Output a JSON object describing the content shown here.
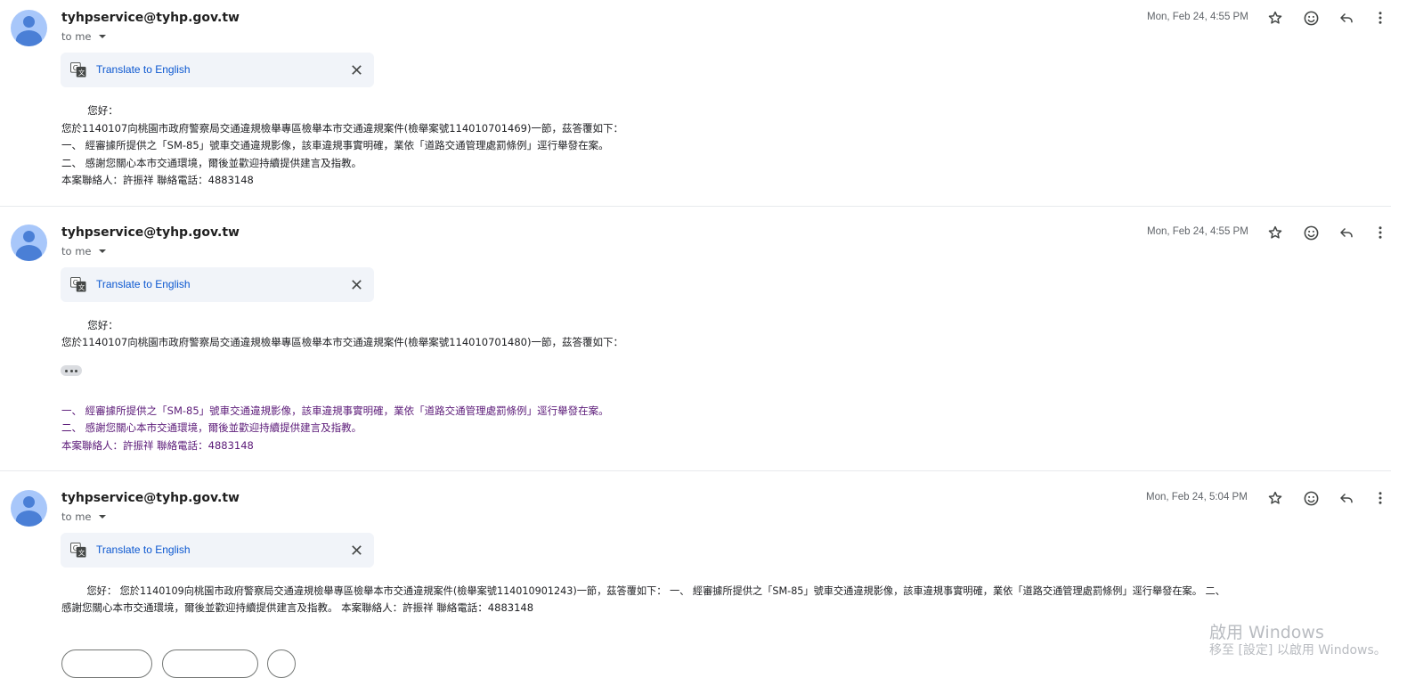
{
  "messages": [
    {
      "sender": "tyhpservice@tyhp.gov.tw",
      "to": "to me",
      "date": "Mon, Feb 24, 4:55 PM",
      "translate": "Translate to English",
      "body": [
        "        您好：",
        "您於1140107向桃園市政府警察局交通違規檢舉專區檢舉本市交通違規案件(檢舉案號114010701469)一節，茲答覆如下：",
        "一、 經審據所提供之「SM-85」號車交通違規影像，該車違規事實明確，業依「道路交通管理處罰條例」逕行舉發在案。",
        "二、 感謝您關心本市交通環境，爾後並歡迎持續提供建言及指教。",
        "本案聯絡人：許振祥 聯絡電話：4883148"
      ]
    },
    {
      "sender": "tyhpservice@tyhp.gov.tw",
      "to": "to me",
      "date": "Mon, Feb 24, 4:55 PM",
      "translate": "Translate to English",
      "body": [
        "        您好：",
        "您於1140107向桃園市政府警察局交通違規檢舉專區檢舉本市交通違規案件(檢舉案號114010701480)一節，茲答覆如下："
      ],
      "quoted": [
        "一、 經審據所提供之「SM-85」號車交通違規影像，該車違規事實明確，業依「道路交通管理處罰條例」逕行舉發在案。",
        "二、 感謝您關心本市交通環境，爾後並歡迎持續提供建言及指教。",
        "本案聯絡人：許振祥 聯絡電話：4883148"
      ]
    },
    {
      "sender": "tyhpservice@tyhp.gov.tw",
      "to": "to me",
      "date": "Mon, Feb 24, 5:04 PM",
      "translate": "Translate to English",
      "body": [
        "        您好： 您於1140109向桃園市政府警察局交通違規檢舉專區檢舉本市交通違規案件(檢舉案號114010901243)一節，茲答覆如下： 一、 經審據所提供之「SM-85」號車交通違規影像，該車違規事實明確，業依「道路交通管理處罰條例」逕行舉發在案。 二、",
        "感謝您關心本市交通環境，爾後並歡迎持續提供建言及指教。 本案聯絡人：許振祥 聯絡電話：4883148"
      ]
    }
  ],
  "watermark": {
    "line1": "啟用 Windows",
    "line2": "移至 [設定] 以啟用 Windows。"
  },
  "icons": [
    "star-icon",
    "emoji-icon",
    "reply-icon",
    "more-vert-icon",
    "translate-icon",
    "close-icon",
    "caret-down-icon"
  ]
}
